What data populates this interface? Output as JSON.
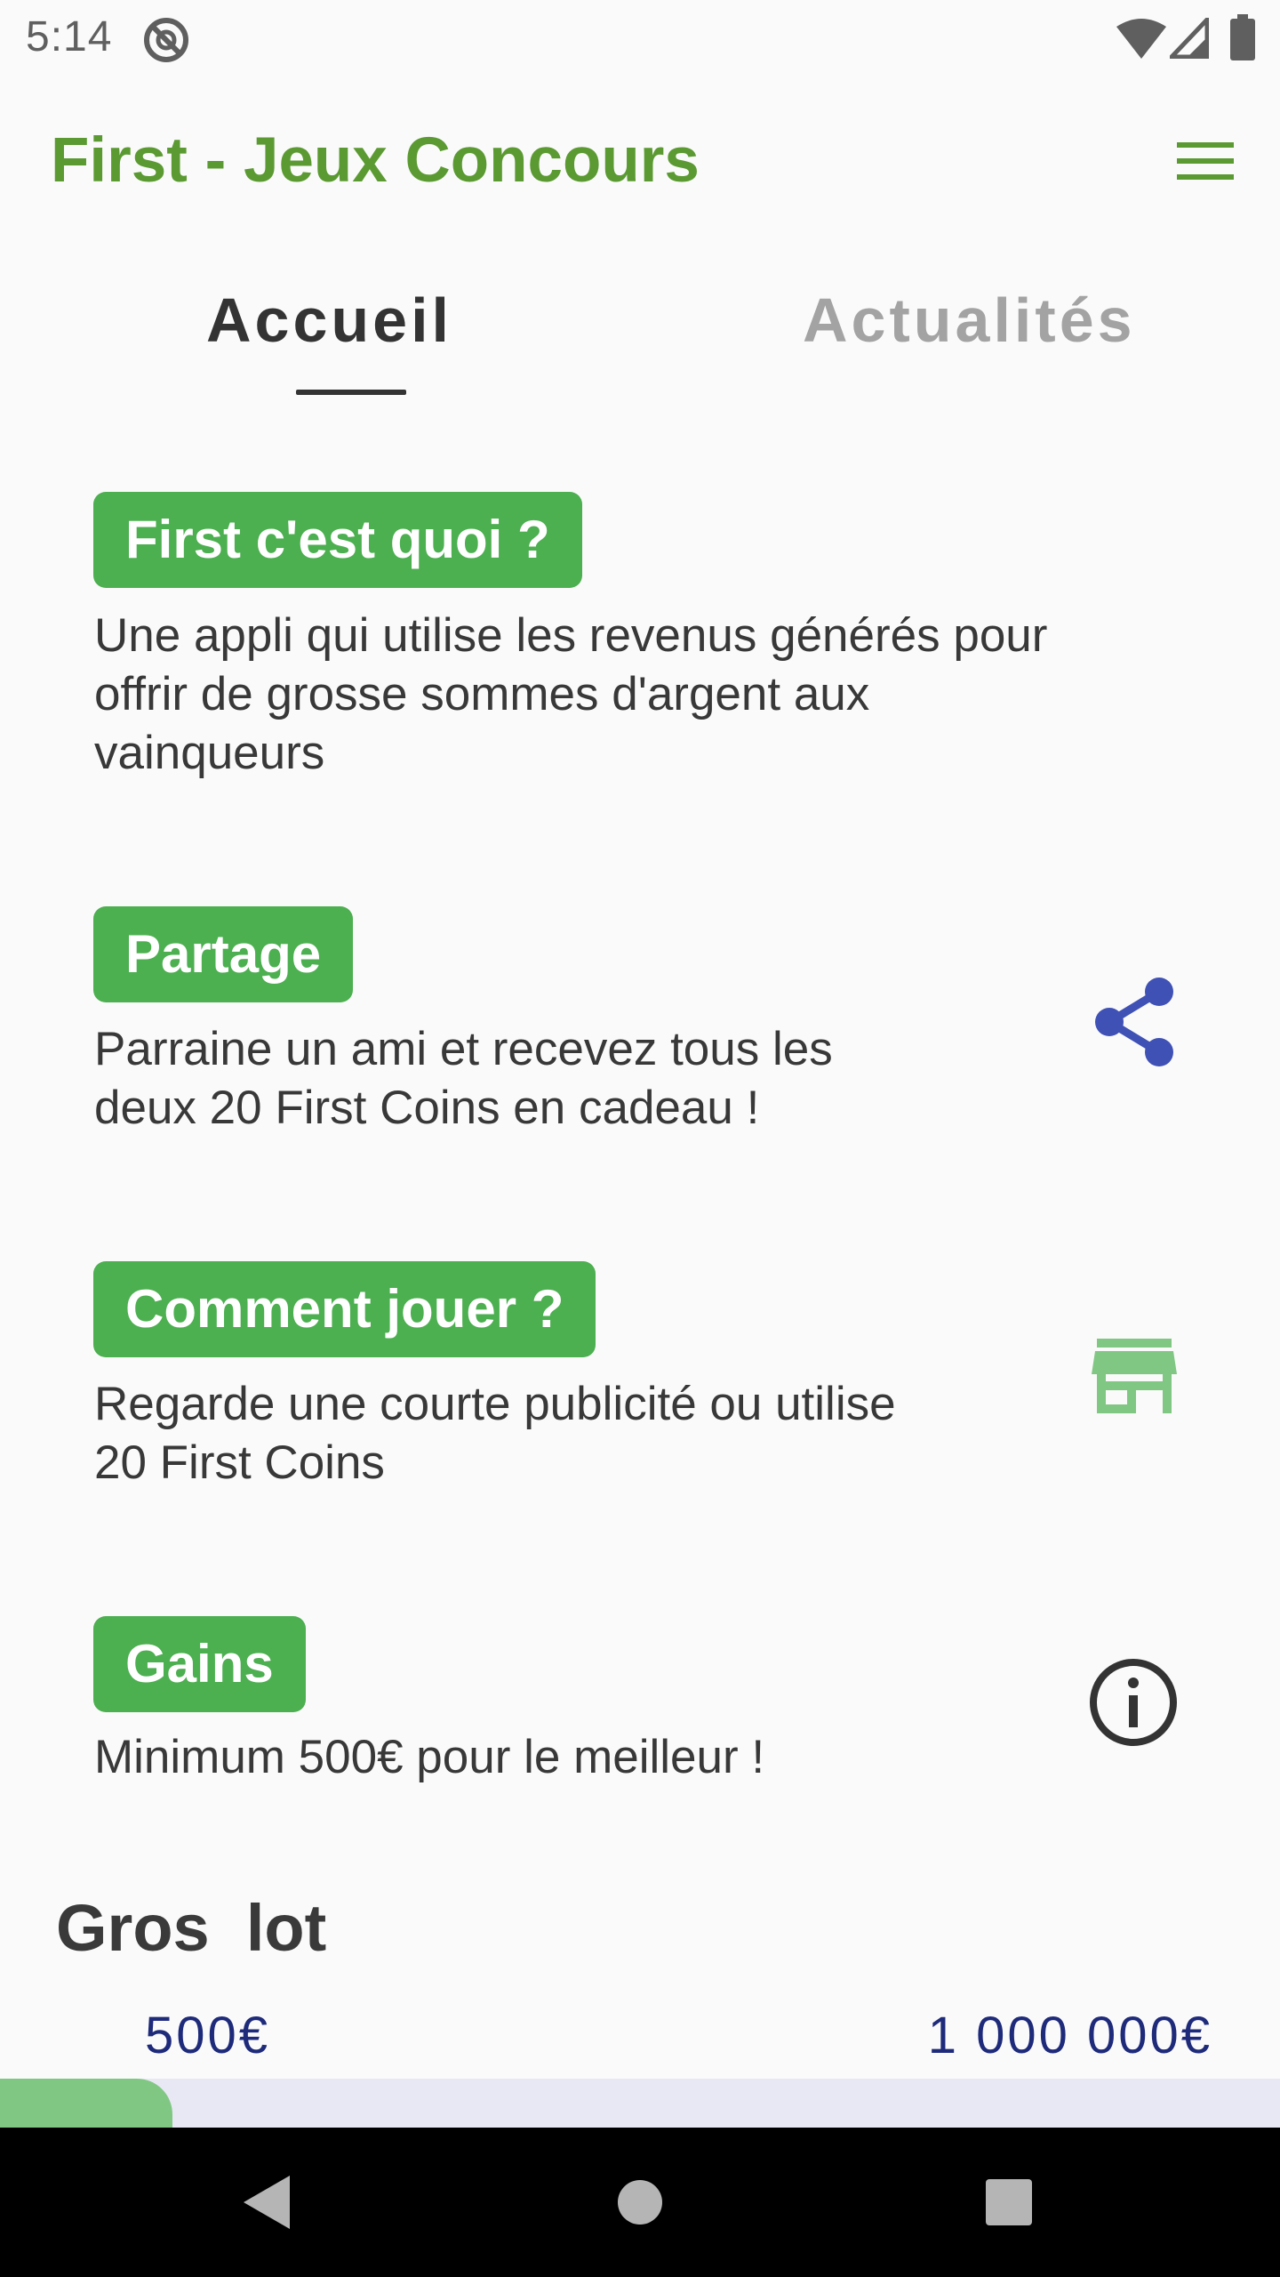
{
  "status_bar": {
    "time": "5:14"
  },
  "app_bar": {
    "title": "First - Jeux Concours",
    "title_color": "#5b9a32"
  },
  "tabs": [
    {
      "label": "Accueil",
      "selected": true
    },
    {
      "label": "Actualités",
      "selected": false
    }
  ],
  "cards": [
    {
      "title": "First c'est quoi ?",
      "lines": [
        "Une appli qui utilise les revenus générés pour",
        "offrir de grosse sommes d'argent aux",
        "vainqueurs"
      ],
      "icon": ""
    },
    {
      "title": "Partage",
      "lines": [
        "Parraine un ami et recevez tous les",
        "deux 20 First Coins en cadeau !"
      ],
      "icon": "share-icon"
    },
    {
      "title": "Comment jouer ?",
      "lines": [
        "Regarde une courte publicité ou utilise",
        "20 First Coins"
      ],
      "icon": "store-icon"
    },
    {
      "title": "Gains",
      "lines": [
        "Minimum 500€ pour le meilleur !"
      ],
      "icon": "info-icon"
    }
  ],
  "jackpot": {
    "title": "Gros  lot",
    "min_label": "500€",
    "max_label": "1 000 000€",
    "progress_fraction": 0.135
  },
  "colors": {
    "badge": "#4caf50",
    "share_icon": "#3f51b5",
    "store_icon": "#81c784",
    "progress_fill": "#81c784",
    "progress_track": "#e8e8f4",
    "jackpot_labels": "#1e2a7a"
  }
}
